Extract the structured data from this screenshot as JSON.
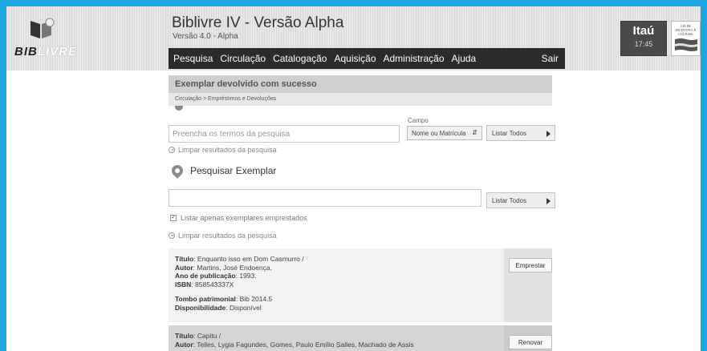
{
  "header": {
    "logo_bold": "BIB",
    "logo_light": "LIVRE",
    "title": "Biblivre IV - Versão Alpha",
    "version": "Versão 4.0 - Alpha",
    "menu": [
      "Pesquisa",
      "Circulação",
      "Catalogação",
      "Aquisição",
      "Administração",
      "Ajuda"
    ],
    "logout": "Sair",
    "sponsor": "Itaú",
    "time": "17:45",
    "culture_seal": "LEI DE INCENTIVO À CULTURA"
  },
  "message": "Exemplar devolvido com sucesso",
  "breadcrumb": "Circulação > Empréstimos e Devoluções",
  "user_search": {
    "placeholder": "Preencha os termos da pesquisa",
    "field_label": "Campo",
    "field_value": "Nome ou Matrícula",
    "list_all": "Listar Todos",
    "clear": "Limpar resultados da pesquisa"
  },
  "copy_search": {
    "title": "Pesquisar Exemplar",
    "value": "",
    "list_all": "Listar Todos",
    "checkbox_label": "Listar apenas exemplares emprestados",
    "checked": true,
    "clear": "Limpar resultados da pesquisa"
  },
  "labels": {
    "title": "Título",
    "author": "Autor",
    "year": "Ano de publicação",
    "isbn": "ISBN",
    "tombo": "Tombo patrimonial",
    "availability": "Disponibilidade"
  },
  "results": [
    {
      "title": "Enquanto isso em Dom Casmurro /",
      "author": "Martins, José Endoença,",
      "year": "1993.",
      "isbn": "858543337X",
      "tombo": "Bib 2014.5",
      "availability": "Disponível",
      "action": "Emprestar"
    },
    {
      "title": "Capitu /",
      "author": "Telles, Lygia Fagundes, Gomes, Paulo Emílio Salles, Machado de Assis",
      "action": "Renovar"
    }
  ],
  "colors": {
    "border": "#1ea6e0",
    "menubar": "#2b2b2b"
  }
}
